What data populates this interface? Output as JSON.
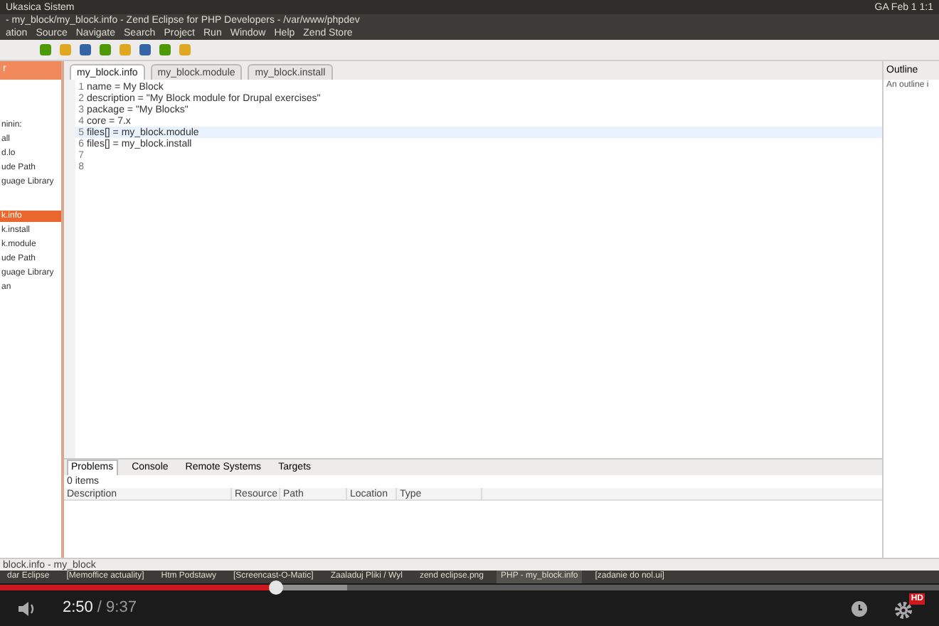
{
  "top_panel": {
    "left": "Ukasica Sistem",
    "right": "GA Feb 1 1:1"
  },
  "window": {
    "title": "- my_block/my_block.info - Zend Eclipse for PHP Developers - /var/www/phpdev"
  },
  "menu": [
    "ation",
    "Source",
    "Navigate",
    "Search",
    "Project",
    "Run",
    "Window",
    "Help",
    "Zend Store"
  ],
  "left_panel": {
    "title": "r",
    "items": [
      {
        "label": "ninin:",
        "selected": false
      },
      {
        "label": "all",
        "selected": false
      },
      {
        "label": "d.lo",
        "selected": false
      },
      {
        "label": "ude Path",
        "selected": false
      },
      {
        "label": "guage Library",
        "selected": false
      },
      {
        "label": "k.info",
        "selected": true
      },
      {
        "label": "k.install",
        "selected": false
      },
      {
        "label": "k.module",
        "selected": false
      },
      {
        "label": "ude Path",
        "selected": false
      },
      {
        "label": "guage Library",
        "selected": false
      },
      {
        "label": "an",
        "selected": false
      }
    ]
  },
  "editor": {
    "tabs": [
      {
        "label": "my_block.info",
        "selected": true
      },
      {
        "label": "my_block.module",
        "selected": false
      },
      {
        "label": "my_block.install",
        "selected": false
      }
    ],
    "lines": [
      {
        "number": "1",
        "text": "name = My Block",
        "selected": false
      },
      {
        "number": "2",
        "text": "description = \"My Block module for Drupal exercises\"",
        "selected": false
      },
      {
        "number": "3",
        "text": "package = \"My Blocks\"",
        "selected": false
      },
      {
        "number": "4",
        "text": "core = 7.x",
        "selected": false
      },
      {
        "number": "5",
        "text": "files[] = my_block.module",
        "selected": true
      },
      {
        "number": "6",
        "text": "files[] = my_block.install",
        "selected": false
      },
      {
        "number": "7",
        "selected": false
      },
      {
        "number": "8",
        "selected": false
      }
    ]
  },
  "outline": {
    "title": "Outline",
    "message": "An outline i"
  },
  "bottom_panel": {
    "tabs": [
      {
        "label": "Problems",
        "selected": true
      },
      {
        "label": "Console",
        "selected": false
      },
      {
        "label": "Remote Systems",
        "selected": false
      },
      {
        "label": "Targets",
        "selected": false
      }
    ],
    "summary": "0 items",
    "columns": [
      "Description",
      "Resource",
      "Path",
      "Location",
      "Type"
    ]
  },
  "status_bar": "block.info - my_block",
  "taskbar": [
    {
      "label": "dar Eclipse",
      "selected": false
    },
    {
      "label": "[Memoffice actuality]",
      "selected": false
    },
    {
      "label": "Htm Podstawy",
      "selected": false
    },
    {
      "label": "[Screencast-O-Matic]",
      "selected": false
    },
    {
      "label": "Zaaladuj Pliki / Wyl",
      "selected": false
    },
    {
      "label": "zend eclipse.png",
      "selected": false
    },
    {
      "label": "PHP - my_block.info",
      "selected": true
    },
    {
      "label": "[zadanie do nol.ui]",
      "selected": false
    }
  ],
  "player": {
    "level": 0.294,
    "time": "2:50",
    "duration": "/ 9:37",
    "hd": "HD"
  }
}
